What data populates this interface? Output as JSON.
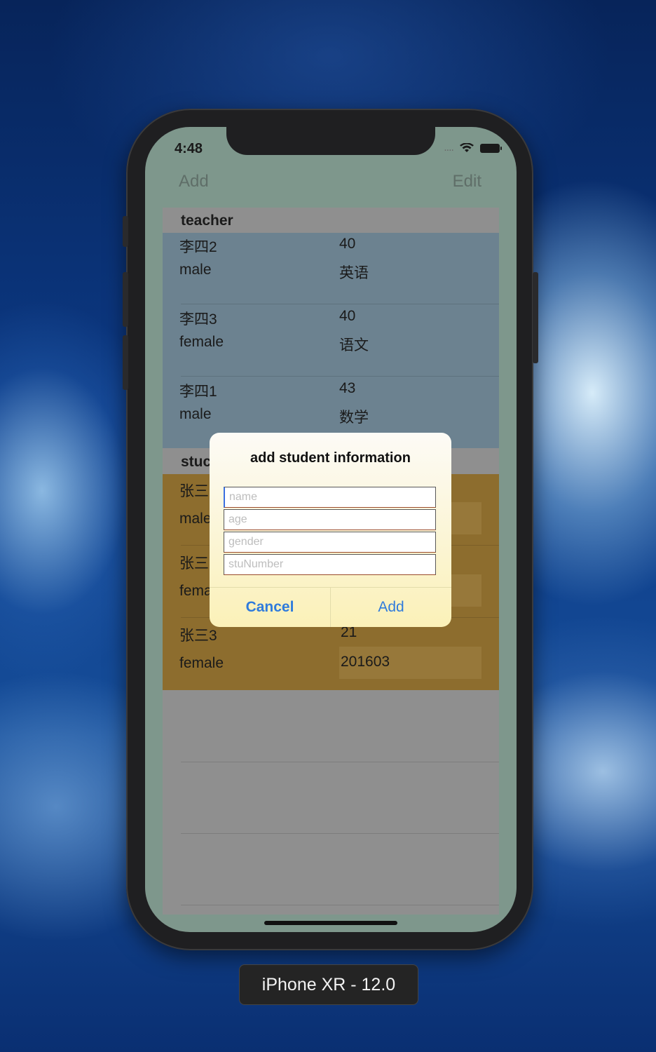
{
  "status_bar": {
    "time": "4:48",
    "signal": "....",
    "wifi_icon": "wifi-icon",
    "battery_icon": "battery-icon"
  },
  "nav": {
    "left_label": "Add",
    "right_label": "Edit"
  },
  "sections": {
    "teacher": {
      "header": "teacher",
      "rows": [
        {
          "name": "李四2",
          "age": "40",
          "gender": "male",
          "subject": "英语"
        },
        {
          "name": "李四3",
          "age": "40",
          "gender": "female",
          "subject": "语文"
        },
        {
          "name": "李四1",
          "age": "43",
          "gender": "male",
          "subject": "数学"
        }
      ]
    },
    "student": {
      "header": "stuc",
      "rows": [
        {
          "name": "张三",
          "gender": "male",
          "age": "",
          "number": ""
        },
        {
          "name": "张三",
          "gender": "fema",
          "age": "",
          "number": ""
        },
        {
          "name": "张三3",
          "gender": "female",
          "age": "21",
          "number": "201603"
        }
      ]
    }
  },
  "alert": {
    "title": "add student information",
    "fields": {
      "name": {
        "placeholder": "name",
        "value": ""
      },
      "age": {
        "placeholder": "age",
        "value": ""
      },
      "gender": {
        "placeholder": "gender",
        "value": ""
      },
      "stu_number": {
        "placeholder": "stuNumber",
        "value": ""
      }
    },
    "cancel_label": "Cancel",
    "add_label": "Add"
  },
  "device_label": "iPhone XR - 12.0",
  "colors": {
    "accent": "#2f7bdc",
    "teacher_bg": "#6c8290",
    "student_bg": "#8d6d2e",
    "screen_bg": "#7e978c"
  }
}
